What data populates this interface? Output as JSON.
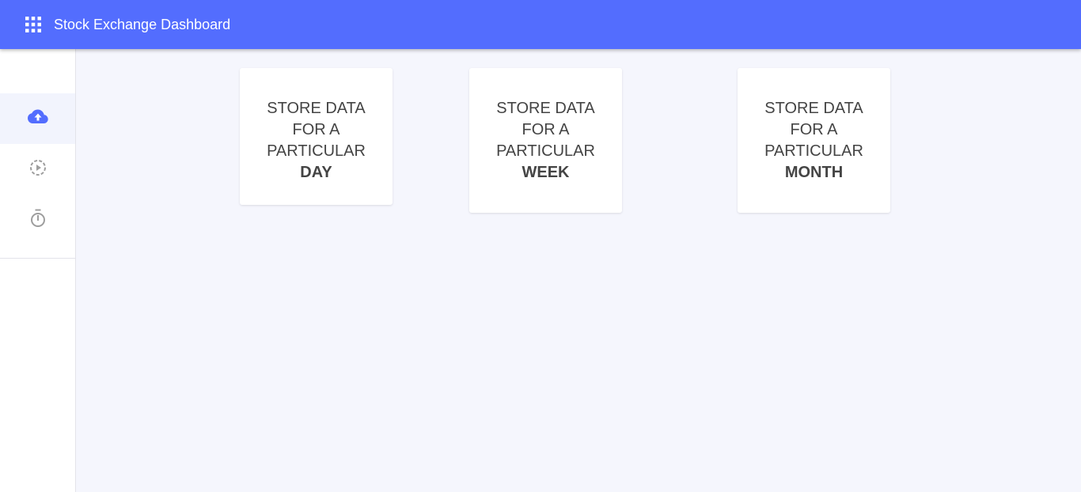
{
  "header": {
    "title": "Stock Exchange Dashboard",
    "menu_icon": "apps-grid-icon",
    "background": "#536dfe"
  },
  "sidebar": {
    "items": [
      {
        "name": "upload",
        "icon": "cloud-upload-icon",
        "active": true,
        "color": "#536dfe"
      },
      {
        "name": "play",
        "icon": "play-circle-icon",
        "active": false,
        "color": "#9e9e9e"
      },
      {
        "name": "timer",
        "icon": "timer-icon",
        "active": false,
        "color": "#9e9e9e"
      }
    ]
  },
  "cards": [
    {
      "line1": "STORE DATA",
      "line2": "FOR A",
      "line3": "PARTICULAR",
      "period": "DAY"
    },
    {
      "line1": "STORE DATA",
      "line2": "FOR A",
      "line3": "PARTICULAR",
      "period": "WEEK"
    },
    {
      "line1": "STORE DATA",
      "line2": "FOR A",
      "line3": "PARTICULAR",
      "period": "MONTH"
    }
  ]
}
